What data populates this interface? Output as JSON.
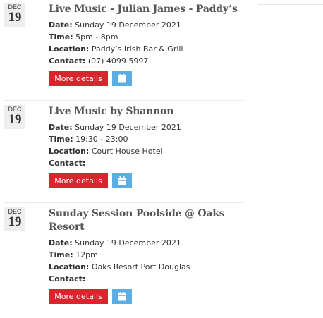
{
  "events": [
    {
      "month": "DEC",
      "day": "19",
      "title": "Live Music - Julian James - Paddy’s",
      "date_label": "Date:",
      "date_value": "Sunday 19 December 2021",
      "time_label": "Time:",
      "time_value": "5pm - 8pm",
      "location_label": "Location:",
      "location_value": "Paddy’s Irish Bar & Grill",
      "contact_label": "Contact:",
      "contact_value": "(07) 4099 5997",
      "more_label": "More details",
      "calendar_icon": "calendar-icon"
    },
    {
      "month": "DEC",
      "day": "19",
      "title": "Live Music by Shannon",
      "date_label": "Date:",
      "date_value": "Sunday 19 December 2021",
      "time_label": "Time:",
      "time_value": "19:30 - 23:00",
      "location_label": "Location:",
      "location_value": "Court House Hotel",
      "contact_label": "Contact:",
      "contact_value": "",
      "more_label": "More details",
      "calendar_icon": "calendar-icon"
    },
    {
      "month": "DEC",
      "day": "19",
      "title": "Sunday Session Poolside @ Oaks Resort",
      "date_label": "Date:",
      "date_value": "Sunday 19 December 2021",
      "time_label": "Time:",
      "time_value": "12pm",
      "location_label": "Location:",
      "location_value": "Oaks Resort Port Douglas",
      "contact_label": "Contact:",
      "contact_value": "",
      "more_label": "More details",
      "calendar_icon": "calendar-icon"
    }
  ],
  "colors": {
    "more_button": "#d9262e",
    "calendar_button": "#5aaee3",
    "date_badge": "#eeeeee",
    "title_text": "#555555"
  }
}
